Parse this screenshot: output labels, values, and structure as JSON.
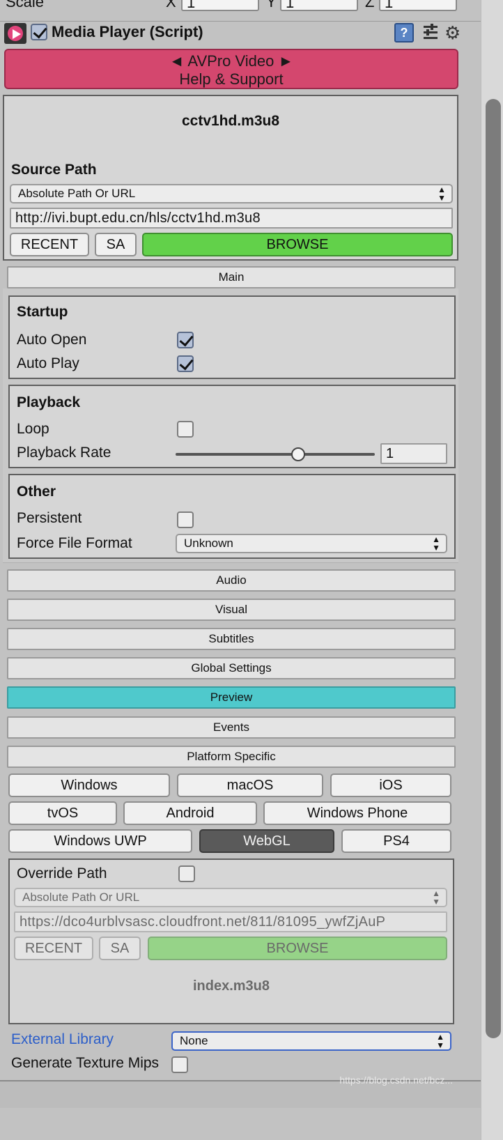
{
  "transform": {
    "scale_label": "Scale",
    "x_label": "X",
    "x_value": "1",
    "y_label": "Y",
    "y_value": "1",
    "z_label": "Z",
    "z_value": "1"
  },
  "component": {
    "enabled": true,
    "title": "Media Player (Script)",
    "help_glyph": "?",
    "gear_glyph": "⚙"
  },
  "banner": {
    "line1": "◄ AVPro Video ►",
    "line2": "Help & Support"
  },
  "source": {
    "file_name": "cctv1hd.m3u8",
    "section_label": "Source Path",
    "path_type": "Absolute Path Or URL",
    "path_value": "http://ivi.bupt.edu.cn/hls/cctv1hd.m3u8",
    "recent_label": "RECENT",
    "sa_label": "SA",
    "browse_label": "BROWSE"
  },
  "sections": {
    "main": "Main",
    "audio": "Audio",
    "visual": "Visual",
    "subtitles": "Subtitles",
    "global_settings": "Global Settings",
    "preview": "Preview",
    "events": "Events",
    "platform_specific": "Platform Specific"
  },
  "startup": {
    "title": "Startup",
    "auto_open_label": "Auto Open",
    "auto_open": true,
    "auto_play_label": "Auto Play",
    "auto_play": true
  },
  "playback": {
    "title": "Playback",
    "loop_label": "Loop",
    "loop": false,
    "rate_label": "Playback Rate",
    "rate_value": "1",
    "rate_slider_fraction": 0.62
  },
  "other": {
    "title": "Other",
    "persistent_label": "Persistent",
    "persistent": false,
    "force_format_label": "Force File Format",
    "force_format_value": "Unknown"
  },
  "platforms": {
    "row1": [
      "Windows",
      "macOS",
      "iOS"
    ],
    "row2": [
      "tvOS",
      "Android",
      "Windows Phone"
    ],
    "row3": [
      "Windows UWP",
      "WebGL",
      "PS4"
    ],
    "selected": "WebGL"
  },
  "platform_override": {
    "override_label": "Override Path",
    "override": false,
    "path_type": "Absolute Path Or URL",
    "path_value": "https://dco4urblvsasc.cloudfront.net/811/81095_ywfZjAuP",
    "recent_label": "RECENT",
    "sa_label": "SA",
    "browse_label": "BROWSE",
    "file_name": "index.m3u8"
  },
  "external": {
    "label": "External Library",
    "value": "None"
  },
  "mips": {
    "label": "Generate Texture Mips",
    "value": false
  },
  "watermark": "https://blog.csdn.net/bcz...",
  "colors": {
    "banner": "#d4476e",
    "browse": "#62d14a",
    "preview": "#4fc9cc",
    "selected_platform": "#5a5a5a",
    "link_blue": "#2c5ec9"
  }
}
